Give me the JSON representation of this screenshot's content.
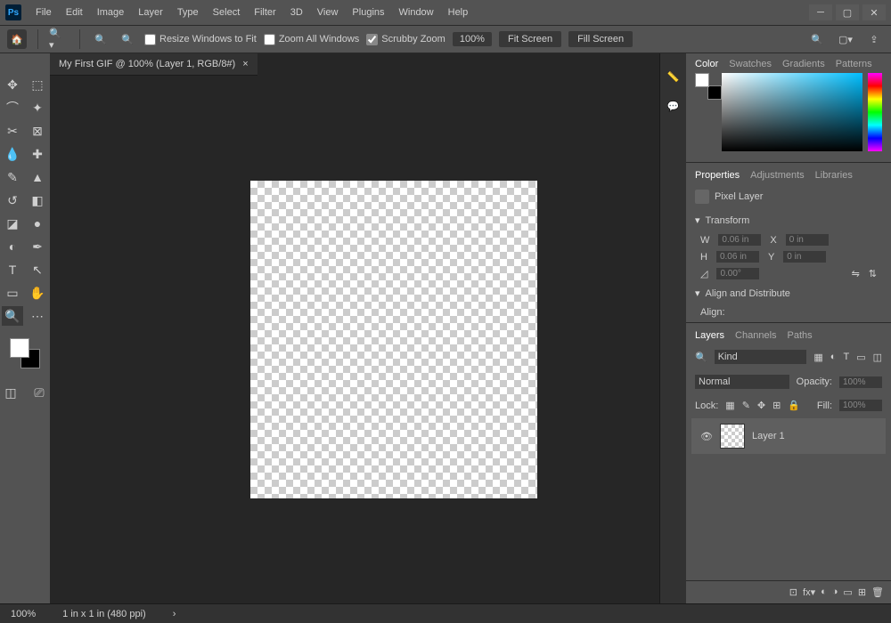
{
  "menubar": [
    "File",
    "Edit",
    "Image",
    "Layer",
    "Type",
    "Select",
    "Filter",
    "3D",
    "View",
    "Plugins",
    "Window",
    "Help"
  ],
  "options": {
    "resize_windows": "Resize Windows to Fit",
    "zoom_all": "Zoom All Windows",
    "scrubby": "Scrubby Zoom",
    "zoom_value": "100%",
    "fit_screen": "Fit Screen",
    "fill_screen": "Fill Screen"
  },
  "doc_tab": "My First GIF @ 100% (Layer 1, RGB/8#)",
  "color_tabs": [
    "Color",
    "Swatches",
    "Gradients",
    "Patterns"
  ],
  "prop_tabs": [
    "Properties",
    "Adjustments",
    "Libraries"
  ],
  "properties": {
    "layer_kind": "Pixel Layer",
    "transform": "Transform",
    "w": "W",
    "w_val": "0.06 in",
    "h": "H",
    "h_val": "0.06 in",
    "x": "X",
    "x_val": "0 in",
    "y": "Y",
    "y_val": "0 in",
    "angle": "0.00°",
    "align_section": "Align and Distribute",
    "align": "Align:"
  },
  "layer_tabs": [
    "Layers",
    "Channels",
    "Paths"
  ],
  "layers": {
    "kind": "Kind",
    "blend": "Normal",
    "opacity_label": "Opacity:",
    "opacity": "100%",
    "lock": "Lock:",
    "fill_label": "Fill:",
    "fill": "100%",
    "layer_name": "Layer 1"
  },
  "status": {
    "zoom": "100%",
    "info": "1 in x 1 in (480 ppi)"
  }
}
